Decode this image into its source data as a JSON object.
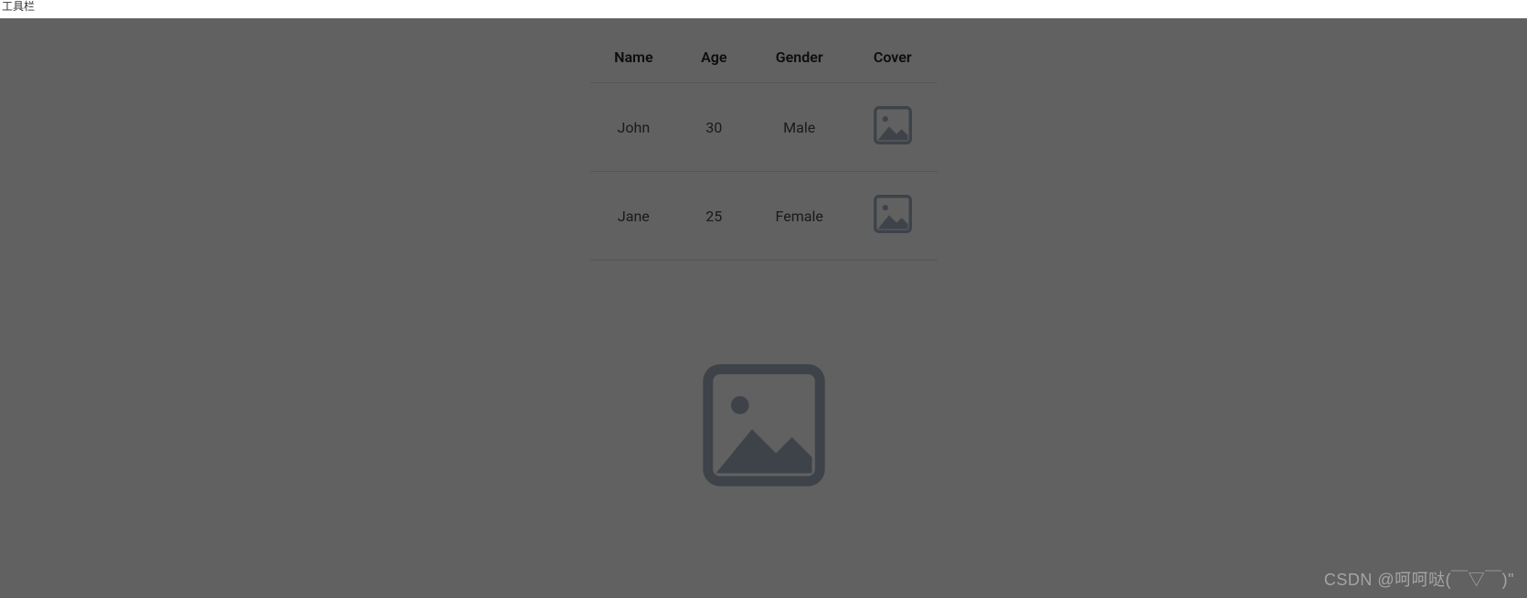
{
  "topbar": {
    "label_fragment": "工具栏"
  },
  "table": {
    "headers": {
      "name": "Name",
      "age": "Age",
      "gender": "Gender",
      "cover": "Cover"
    },
    "rows": [
      {
        "name": "John",
        "age": "30",
        "gender": "Male"
      },
      {
        "name": "Jane",
        "age": "25",
        "gender": "Female"
      }
    ]
  },
  "watermark": {
    "text": "CSDN @呵呵哒(￣▽￣)\""
  },
  "icons": {
    "placeholder_color": "#a4b1c2",
    "placeholder_bg": "transparent"
  }
}
